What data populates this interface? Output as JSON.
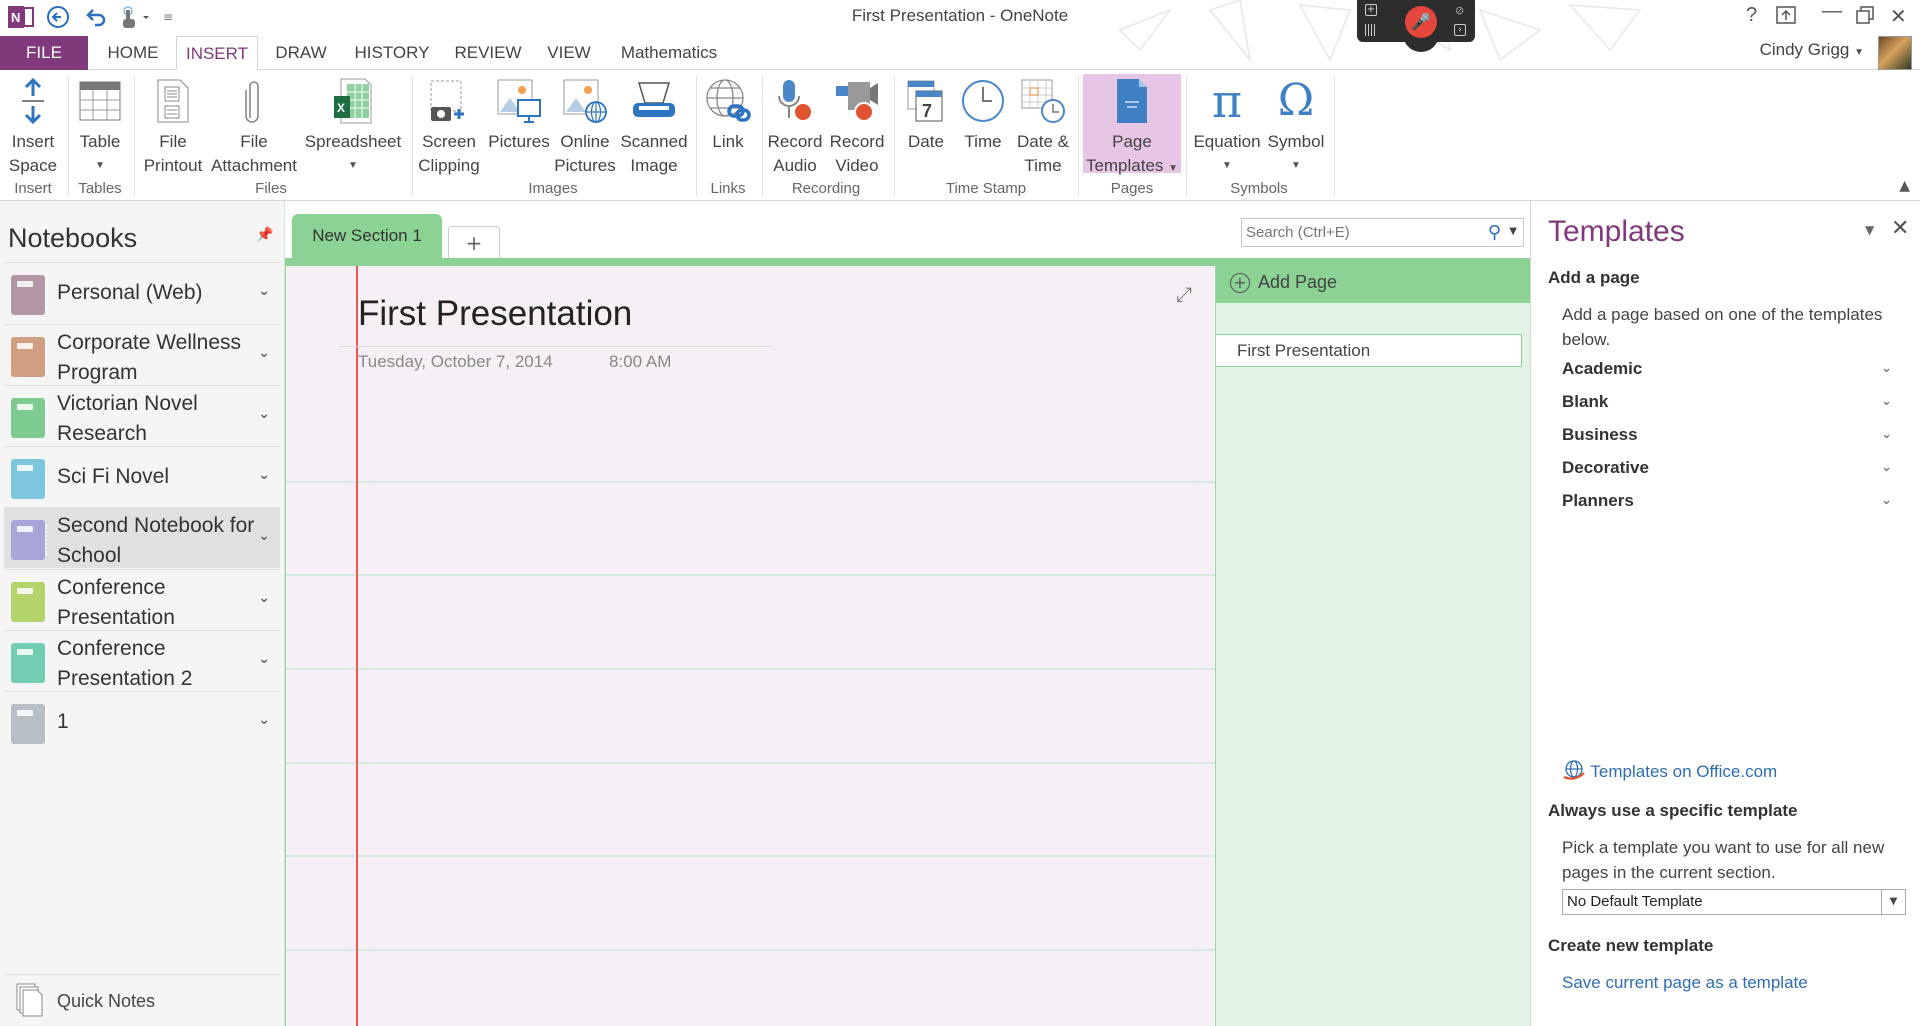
{
  "window": {
    "title": "First Presentation - OneNote",
    "help": "?",
    "user_name": "Cindy Grigg"
  },
  "tabs": [
    "FILE",
    "HOME",
    "INSERT",
    "DRAW",
    "HISTORY",
    "REVIEW",
    "VIEW",
    "Mathematics"
  ],
  "active_tab": "INSERT",
  "ribbon": {
    "buttons": {
      "insert_space": "Insert\nSpace",
      "table": "Table",
      "file_printout": "File\nPrintout",
      "file_attachment": "File\nAttachment",
      "spreadsheet": "Spreadsheet",
      "screen_clipping": "Screen\nClipping",
      "pictures": "Pictures",
      "online_pictures": "Online\nPictures",
      "scanned_image": "Scanned\nImage",
      "link": "Link",
      "record_audio": "Record\nAudio",
      "record_video": "Record\nVideo",
      "date": "Date",
      "time": "Time",
      "date_time": "Date &\nTime",
      "page_templates": "Page\nTemplates",
      "equation": "Equation",
      "symbol": "Symbol"
    },
    "groups": {
      "insert": "Insert",
      "tables": "Tables",
      "files": "Files",
      "images": "Images",
      "links": "Links",
      "recording": "Recording",
      "time_stamp": "Time Stamp",
      "pages": "Pages",
      "symbols": "Symbols"
    }
  },
  "sidebar": {
    "title": "Notebooks",
    "notebooks": [
      {
        "name": "Personal (Web)",
        "color": "#b497a6"
      },
      {
        "name": "Corporate Wellness Program",
        "color": "#d09e80"
      },
      {
        "name": "Victorian Novel Research",
        "color": "#7dcb8e"
      },
      {
        "name": "Sci Fi Novel",
        "color": "#7ec6de"
      },
      {
        "name": "Second Notebook for School",
        "color": "#a8a6d8",
        "selected": true
      },
      {
        "name": "Conference Presentation",
        "color": "#b3d36b"
      },
      {
        "name": "Conference Presentation 2",
        "color": "#72cdb2"
      },
      {
        "name": "1",
        "color": "#b8bec6"
      }
    ],
    "quick_notes": "Quick Notes"
  },
  "section": {
    "tab_label": "New Section 1",
    "add_label": "+",
    "color": "#8bd294"
  },
  "search": {
    "placeholder": "Search (Ctrl+E)"
  },
  "page": {
    "title": "First Presentation",
    "date": "Tuesday, October 7, 2014",
    "time": "8:00 AM"
  },
  "page_list": {
    "add_page": "Add Page",
    "pages": [
      "First Presentation"
    ]
  },
  "templates": {
    "title": "Templates",
    "add_heading": "Add a page",
    "add_desc": "Add a page based on one of the templates below.",
    "categories": [
      "Academic",
      "Blank",
      "Business",
      "Decorative",
      "Planners"
    ],
    "office_link": "Templates on Office.com",
    "always_heading": "Always use a specific template",
    "always_desc": "Pick a template you want to use for all new pages in the current section.",
    "default_select": "No Default Template",
    "create_heading": "Create new template",
    "save_link": "Save current page as a template"
  }
}
